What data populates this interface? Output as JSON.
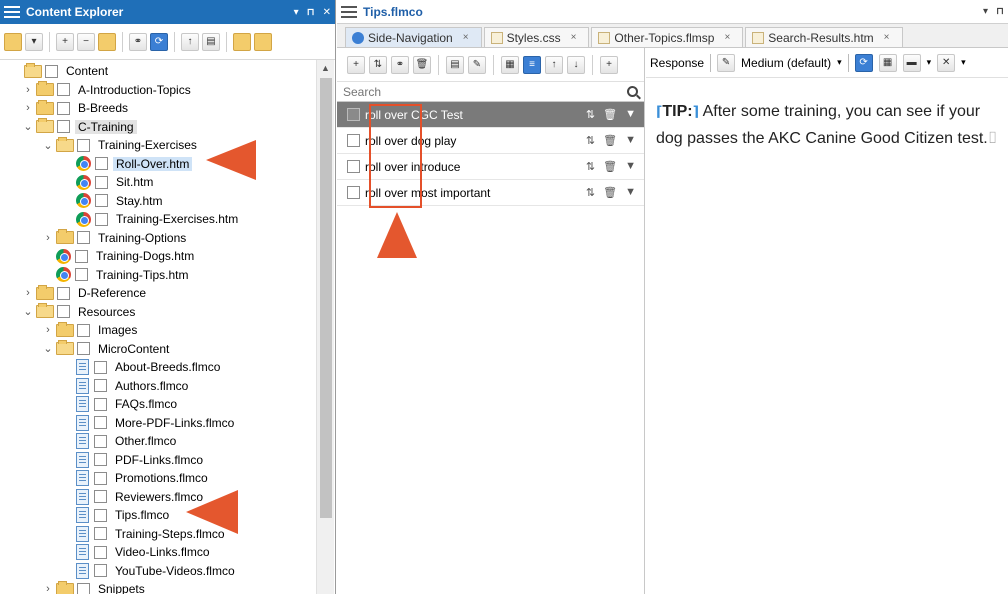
{
  "explorer": {
    "title": "Content Explorer",
    "pin_label": "▾ ⊓ ✕",
    "tree": [
      {
        "label": "Content",
        "type": "folder-open",
        "indent": 0,
        "chev": ""
      },
      {
        "label": "A-Introduction-Topics",
        "type": "folder",
        "indent": 1,
        "chev": "›"
      },
      {
        "label": "B-Breeds",
        "type": "folder",
        "indent": 1,
        "chev": "›"
      },
      {
        "label": "C-Training",
        "type": "folder-open",
        "indent": 1,
        "chev": "⌄",
        "state": "selected-gray"
      },
      {
        "label": "Training-Exercises",
        "type": "folder-open",
        "indent": 2,
        "chev": "⌄"
      },
      {
        "label": "Roll-Over.htm",
        "type": "chrome",
        "indent": 3,
        "chev": "",
        "state": "selected"
      },
      {
        "label": "Sit.htm",
        "type": "chrome",
        "indent": 3,
        "chev": ""
      },
      {
        "label": "Stay.htm",
        "type": "chrome",
        "indent": 3,
        "chev": ""
      },
      {
        "label": "Training-Exercises.htm",
        "type": "chrome",
        "indent": 3,
        "chev": ""
      },
      {
        "label": "Training-Options",
        "type": "folder",
        "indent": 2,
        "chev": "›"
      },
      {
        "label": "Training-Dogs.htm",
        "type": "chrome",
        "indent": 2,
        "chev": ""
      },
      {
        "label": "Training-Tips.htm",
        "type": "chrome",
        "indent": 2,
        "chev": ""
      },
      {
        "label": "D-Reference",
        "type": "folder",
        "indent": 1,
        "chev": "›"
      },
      {
        "label": "Resources",
        "type": "folder-open",
        "indent": 1,
        "chev": "⌄"
      },
      {
        "label": "Images",
        "type": "folder",
        "indent": 2,
        "chev": "›"
      },
      {
        "label": "MicroContent",
        "type": "folder-open",
        "indent": 2,
        "chev": "⌄"
      },
      {
        "label": "About-Breeds.flmco",
        "type": "doc",
        "indent": 3,
        "chev": ""
      },
      {
        "label": "Authors.flmco",
        "type": "doc",
        "indent": 3,
        "chev": ""
      },
      {
        "label": "FAQs.flmco",
        "type": "doc",
        "indent": 3,
        "chev": ""
      },
      {
        "label": "More-PDF-Links.flmco",
        "type": "doc",
        "indent": 3,
        "chev": ""
      },
      {
        "label": "Other.flmco",
        "type": "doc",
        "indent": 3,
        "chev": ""
      },
      {
        "label": "PDF-Links.flmco",
        "type": "doc",
        "indent": 3,
        "chev": ""
      },
      {
        "label": "Promotions.flmco",
        "type": "doc",
        "indent": 3,
        "chev": ""
      },
      {
        "label": "Reviewers.flmco",
        "type": "doc",
        "indent": 3,
        "chev": ""
      },
      {
        "label": "Tips.flmco",
        "type": "doc",
        "indent": 3,
        "chev": ""
      },
      {
        "label": "Training-Steps.flmco",
        "type": "doc",
        "indent": 3,
        "chev": ""
      },
      {
        "label": "Video-Links.flmco",
        "type": "doc",
        "indent": 3,
        "chev": ""
      },
      {
        "label": "YouTube-Videos.flmco",
        "type": "doc",
        "indent": 3,
        "chev": ""
      },
      {
        "label": "Snippets",
        "type": "folder",
        "indent": 2,
        "chev": "›"
      }
    ]
  },
  "editor": {
    "title": "Tips.flmco",
    "tabs": [
      {
        "label": "Side-Navigation",
        "icon": "gear",
        "active": true
      },
      {
        "label": "Styles.css",
        "icon": "file",
        "active": false
      },
      {
        "label": "Other-Topics.flmsp",
        "icon": "file",
        "active": false
      },
      {
        "label": "Search-Results.htm",
        "icon": "file",
        "active": false
      }
    ],
    "tab_close": "×"
  },
  "microcontent": {
    "search_placeholder": "Search",
    "phrases": [
      {
        "label": "roll over CGC Test",
        "selected": true
      },
      {
        "label": "roll over dog play",
        "selected": false
      },
      {
        "label": "roll over introduce",
        "selected": false
      },
      {
        "label": "roll over most important",
        "selected": false
      }
    ]
  },
  "response": {
    "response_label": "Response",
    "medium_label": "Medium (default)",
    "tip_label": "TIP:",
    "body_text": "After some training, you can see if your dog passes the AKC Canine Good Citizen test."
  }
}
